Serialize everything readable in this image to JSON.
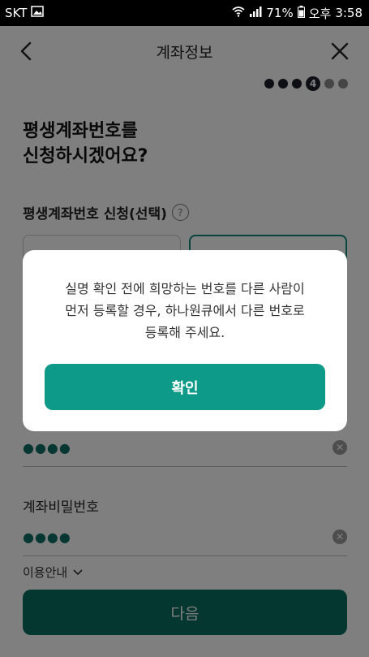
{
  "status_bar": {
    "carrier": "SKT",
    "battery": "71%",
    "ampm": "오후",
    "time": "3:58"
  },
  "header": {
    "title": "계좌정보"
  },
  "progress": {
    "current_step": "4",
    "total_steps": 6
  },
  "form": {
    "question_line1": "평생계좌번호를",
    "question_line2": "신청하시겠어요?",
    "section_label": "평생계좌번호 신청(선택)",
    "help_glyph": "?",
    "field1_value": "●●●●",
    "password_label": "계좌비밀번호",
    "password_value": "●●●●",
    "clear_glyph": "✕",
    "guide_label": "이용안내",
    "next_label": "다음"
  },
  "modal": {
    "message_line1": "실명 확인 전에 희망하는 번호를 다른 사람이",
    "message_line2": "먼저 등록할 경우, 하나원큐에서 다른 번호로",
    "message_line3": "등록해 주세요.",
    "confirm_label": "확인"
  },
  "colors": {
    "accent": "#0e9a89",
    "next_button": "#0a6f63",
    "overlay": "rgba(0,0,0,0.5)"
  }
}
